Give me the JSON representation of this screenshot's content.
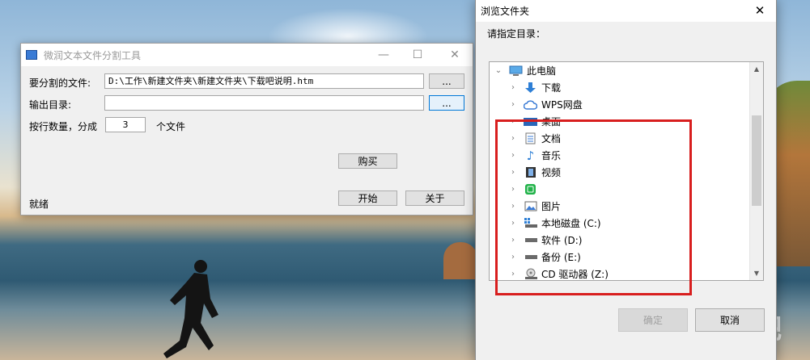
{
  "tool_window": {
    "title": "微润文本文件分割工具",
    "file_label": "要分割的文件:",
    "file_value": "D:\\工作\\新建文件夹\\新建文件夹\\下载吧说明.htm",
    "browse1_label": "...",
    "output_label": "输出目录:",
    "output_value": "",
    "browse2_label": "...",
    "count_label": "按行数量，分成",
    "count_value": "3",
    "count_unit": "个文件",
    "buy_label": "购买",
    "start_label": "开始",
    "about_label": "关于",
    "status": "就绪"
  },
  "folder_dialog": {
    "title": "浏览文件夹",
    "prompt": "请指定目录：",
    "tree": [
      {
        "label": "此电脑",
        "icon": "computer-icon",
        "expanded": true
      },
      {
        "label": "下载",
        "icon": "download-icon"
      },
      {
        "label": "WPS网盘",
        "icon": "cloud-icon"
      },
      {
        "label": "桌面",
        "icon": "desktop-icon"
      },
      {
        "label": "文档",
        "icon": "document-icon"
      },
      {
        "label": "音乐",
        "icon": "music-icon"
      },
      {
        "label": "视频",
        "icon": "video-icon"
      },
      {
        "label": "",
        "icon": "iqiyi-icon"
      },
      {
        "label": "图片",
        "icon": "picture-icon"
      },
      {
        "label": "本地磁盘 (C:)",
        "icon": "drive-icon"
      },
      {
        "label": "软件 (D:)",
        "icon": "drive-icon"
      },
      {
        "label": "备份 (E:)",
        "icon": "drive-icon"
      },
      {
        "label": "CD 驱动器 (Z:)",
        "icon": "cd-icon"
      }
    ],
    "ok_label": "确定",
    "cancel_label": "取消"
  },
  "watermark": "下载吧",
  "colors": {
    "highlight_red": "#d81e1e",
    "focus_blue": "#0078d7"
  }
}
